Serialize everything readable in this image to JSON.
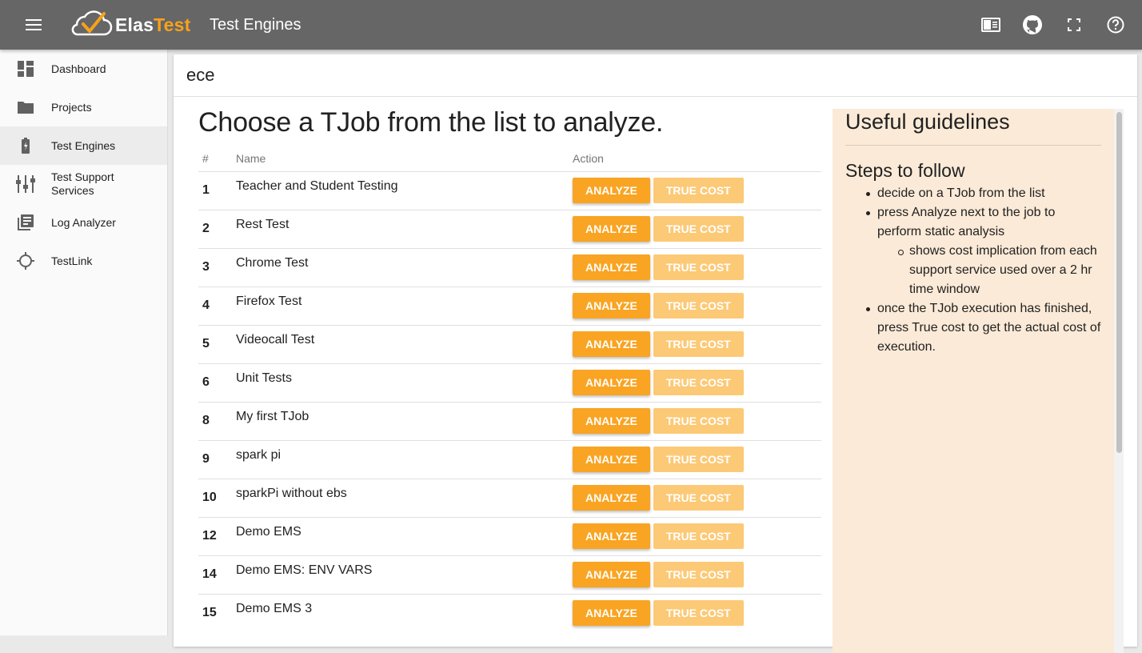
{
  "header": {
    "logo_part1": "Elas",
    "logo_part2": "Test",
    "title": "Test Engines",
    "icons": [
      "menu-icon",
      "elastest-logo-icon",
      "book-icon",
      "github-icon",
      "fullscreen-icon",
      "help-icon"
    ]
  },
  "sidebar": {
    "items": [
      {
        "label": "Dashboard",
        "icon": "dashboard-icon"
      },
      {
        "label": "Projects",
        "icon": "folder-icon"
      },
      {
        "label": "Test Engines",
        "icon": "battery-icon",
        "active": true
      },
      {
        "label": "Test Support Services",
        "icon": "sliders-icon"
      },
      {
        "label": "Log Analyzer",
        "icon": "library-books-icon"
      },
      {
        "label": "TestLink",
        "icon": "crosshair-icon"
      }
    ]
  },
  "card": {
    "header": "ece",
    "heading": "Choose a TJob from the list to analyze.",
    "columns": {
      "num": "#",
      "name": "Name",
      "action": "Action"
    },
    "buttons": {
      "analyze": "ANALYZE",
      "true_cost": "TRUE COST"
    },
    "rows": [
      {
        "id": "1",
        "name": "Teacher and Student Testing"
      },
      {
        "id": "2",
        "name": "Rest Test"
      },
      {
        "id": "3",
        "name": "Chrome Test"
      },
      {
        "id": "4",
        "name": "Firefox Test"
      },
      {
        "id": "5",
        "name": "Videocall Test"
      },
      {
        "id": "6",
        "name": "Unit Tests"
      },
      {
        "id": "8",
        "name": "My first TJob"
      },
      {
        "id": "9",
        "name": "spark pi"
      },
      {
        "id": "10",
        "name": "sparkPi without ebs"
      },
      {
        "id": "12",
        "name": "Demo EMS"
      },
      {
        "id": "14",
        "name": "Demo EMS: ENV VARS"
      },
      {
        "id": "15",
        "name": "Demo EMS 3"
      }
    ]
  },
  "guidelines": {
    "title": "Useful guidelines",
    "subtitle": "Steps to follow",
    "steps": [
      {
        "text": "decide on a TJob from the list",
        "sub": false
      },
      {
        "text": "press Analyze next to the job to perform static analysis",
        "sub": false
      },
      {
        "text": "shows cost implication from each support service used over a 2 hr time window",
        "sub": true
      },
      {
        "text": "once the TJob execution has finished, press True cost to get the actual cost of execution.",
        "sub": false
      }
    ]
  },
  "colors": {
    "topbar": "#666666",
    "accent": "#f9a423",
    "accent_light": "#fcc976",
    "guide_bg": "#fbead7"
  }
}
